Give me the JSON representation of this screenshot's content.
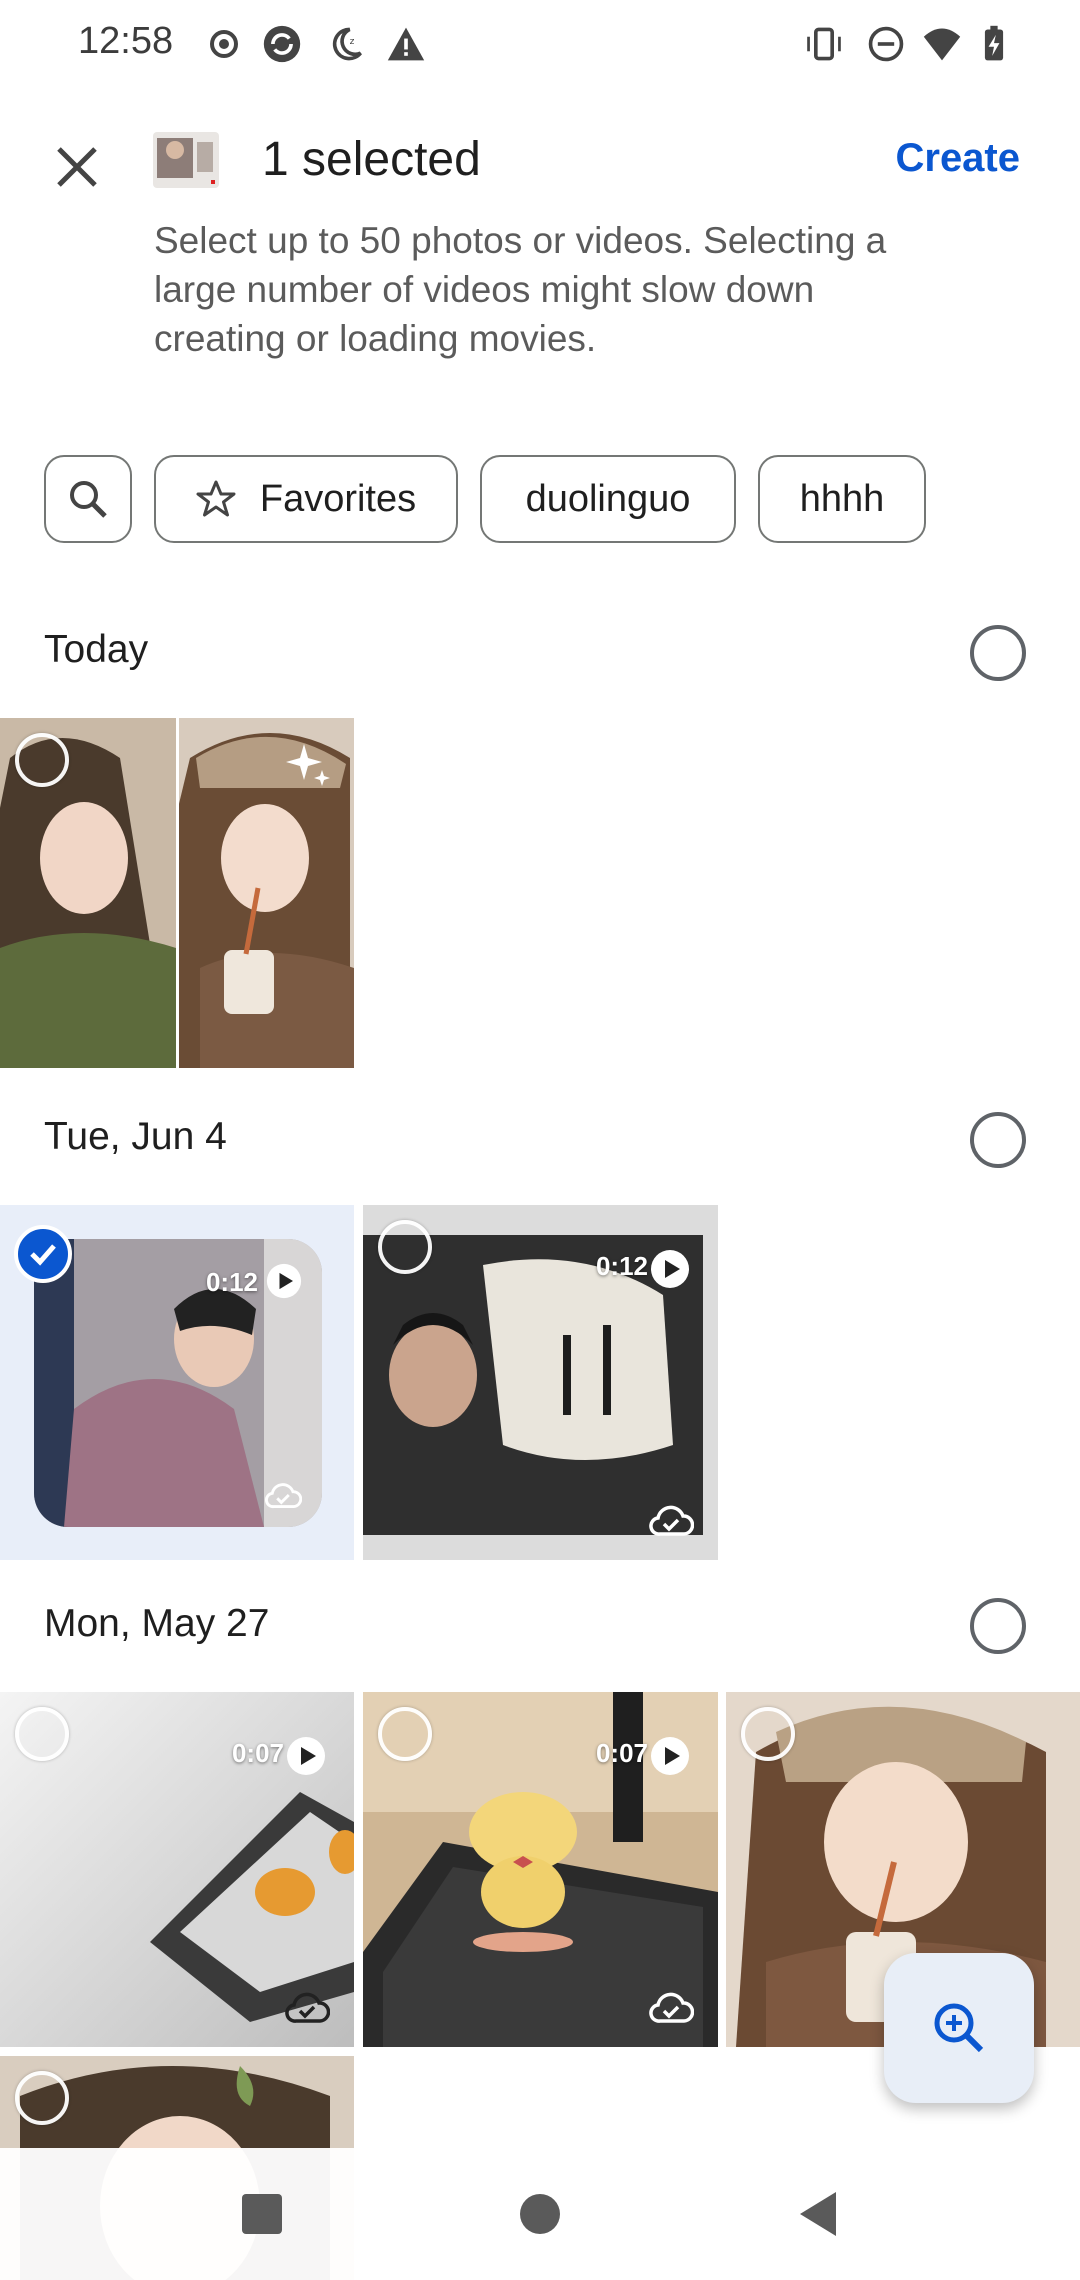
{
  "status_bar": {
    "time": "12:58",
    "left_icons": [
      "record-icon",
      "sync-icon",
      "do-not-disturb-moon-icon",
      "warning-icon"
    ],
    "right_icons": [
      "vibrate-icon",
      "dnd-icon",
      "wifi-icon",
      "battery-icon"
    ]
  },
  "header": {
    "selected_label": "1 selected",
    "create_label": "Create",
    "hint": "Select up to 50 photos or videos. Selecting a large number of videos might slow down creating or loading movies."
  },
  "chips": {
    "favorites": "Favorites",
    "tag1": "duolinguo",
    "tag2": "hhhh"
  },
  "sections": [
    {
      "title": "Today"
    },
    {
      "title": "Tue, Jun 4"
    },
    {
      "title": "Mon, May 27"
    }
  ],
  "videos": {
    "jun4_1_duration": "0:12",
    "jun4_2_duration": "0:12",
    "may27_1_duration": "0:07",
    "may27_2_duration": "0:07"
  },
  "colors": {
    "accent": "#0b57d0",
    "selected_tile_bg": "#e8eef9"
  }
}
